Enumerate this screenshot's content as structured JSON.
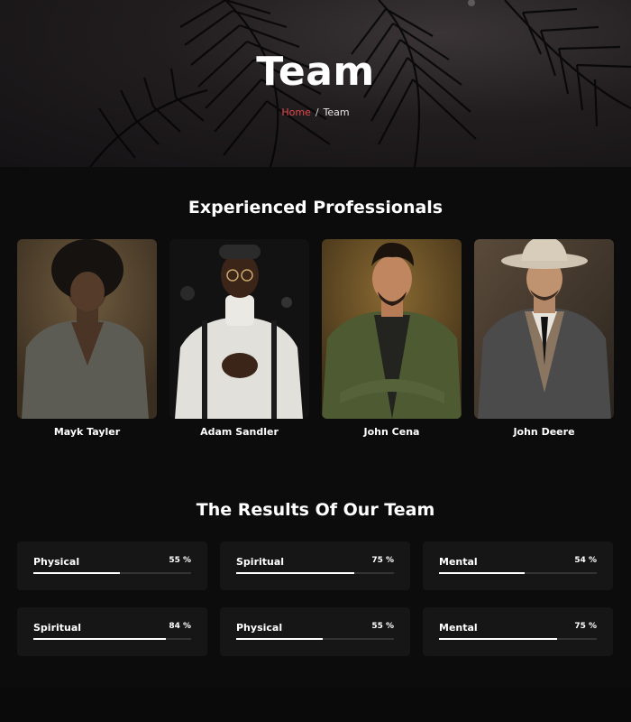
{
  "hero": {
    "title": "Team",
    "breadcrumb": {
      "home": "Home",
      "separator": "/",
      "current": "Team"
    }
  },
  "professionals": {
    "title": "Experienced Professionals",
    "members": [
      {
        "name": "Mayk Tayler"
      },
      {
        "name": "Adam Sandler"
      },
      {
        "name": "John Cena"
      },
      {
        "name": "John Deere"
      }
    ]
  },
  "results": {
    "title": "The Results Of Our Team",
    "skills": [
      {
        "label": "Physical",
        "percent_text": "55 %",
        "value": 55
      },
      {
        "label": "Spiritual",
        "percent_text": "75 %",
        "value": 75
      },
      {
        "label": "Mental",
        "percent_text": "54 %",
        "value": 54
      },
      {
        "label": "Spiritual",
        "percent_text": "84 %",
        "value": 84
      },
      {
        "label": "Physical",
        "percent_text": "55 %",
        "value": 55
      },
      {
        "label": "Mental",
        "percent_text": "75 %",
        "value": 75
      }
    ]
  },
  "colors": {
    "accent": "#e2474b",
    "background": "#0c0c0c",
    "card": "#161616"
  }
}
